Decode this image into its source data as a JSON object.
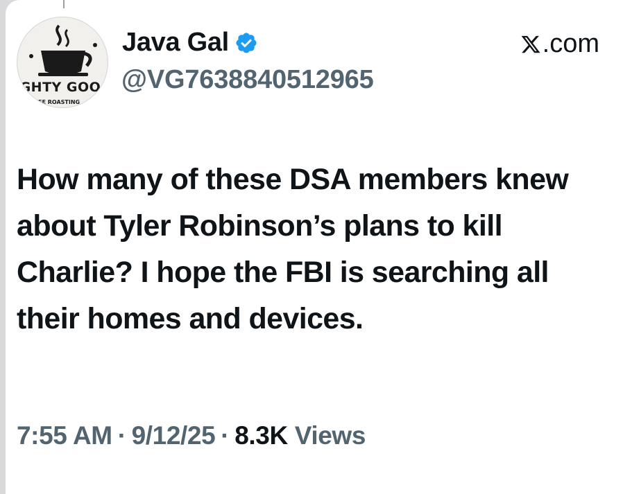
{
  "post": {
    "author": {
      "display_name": "Java Gal",
      "handle": "@VG7638840512965",
      "verified": true,
      "avatar_text_top": "IGHTY GOO",
      "avatar_text_bottom": "EE ROASTING"
    },
    "site_label": ".com",
    "site_icon": "x-logo-icon",
    "text": "How many of these DSA members knew about Tyler Robinson’s plans to kill Charlie? I hope the FBI is searching all their homes and devices.",
    "time": "7:55 AM",
    "separator": "·",
    "date": "9/12/25",
    "views_count": "8.3K",
    "views_label": "Views"
  },
  "colors": {
    "verified_badge": "#1d9bf0",
    "primary_text": "#0f1419",
    "secondary_text": "#536471"
  }
}
